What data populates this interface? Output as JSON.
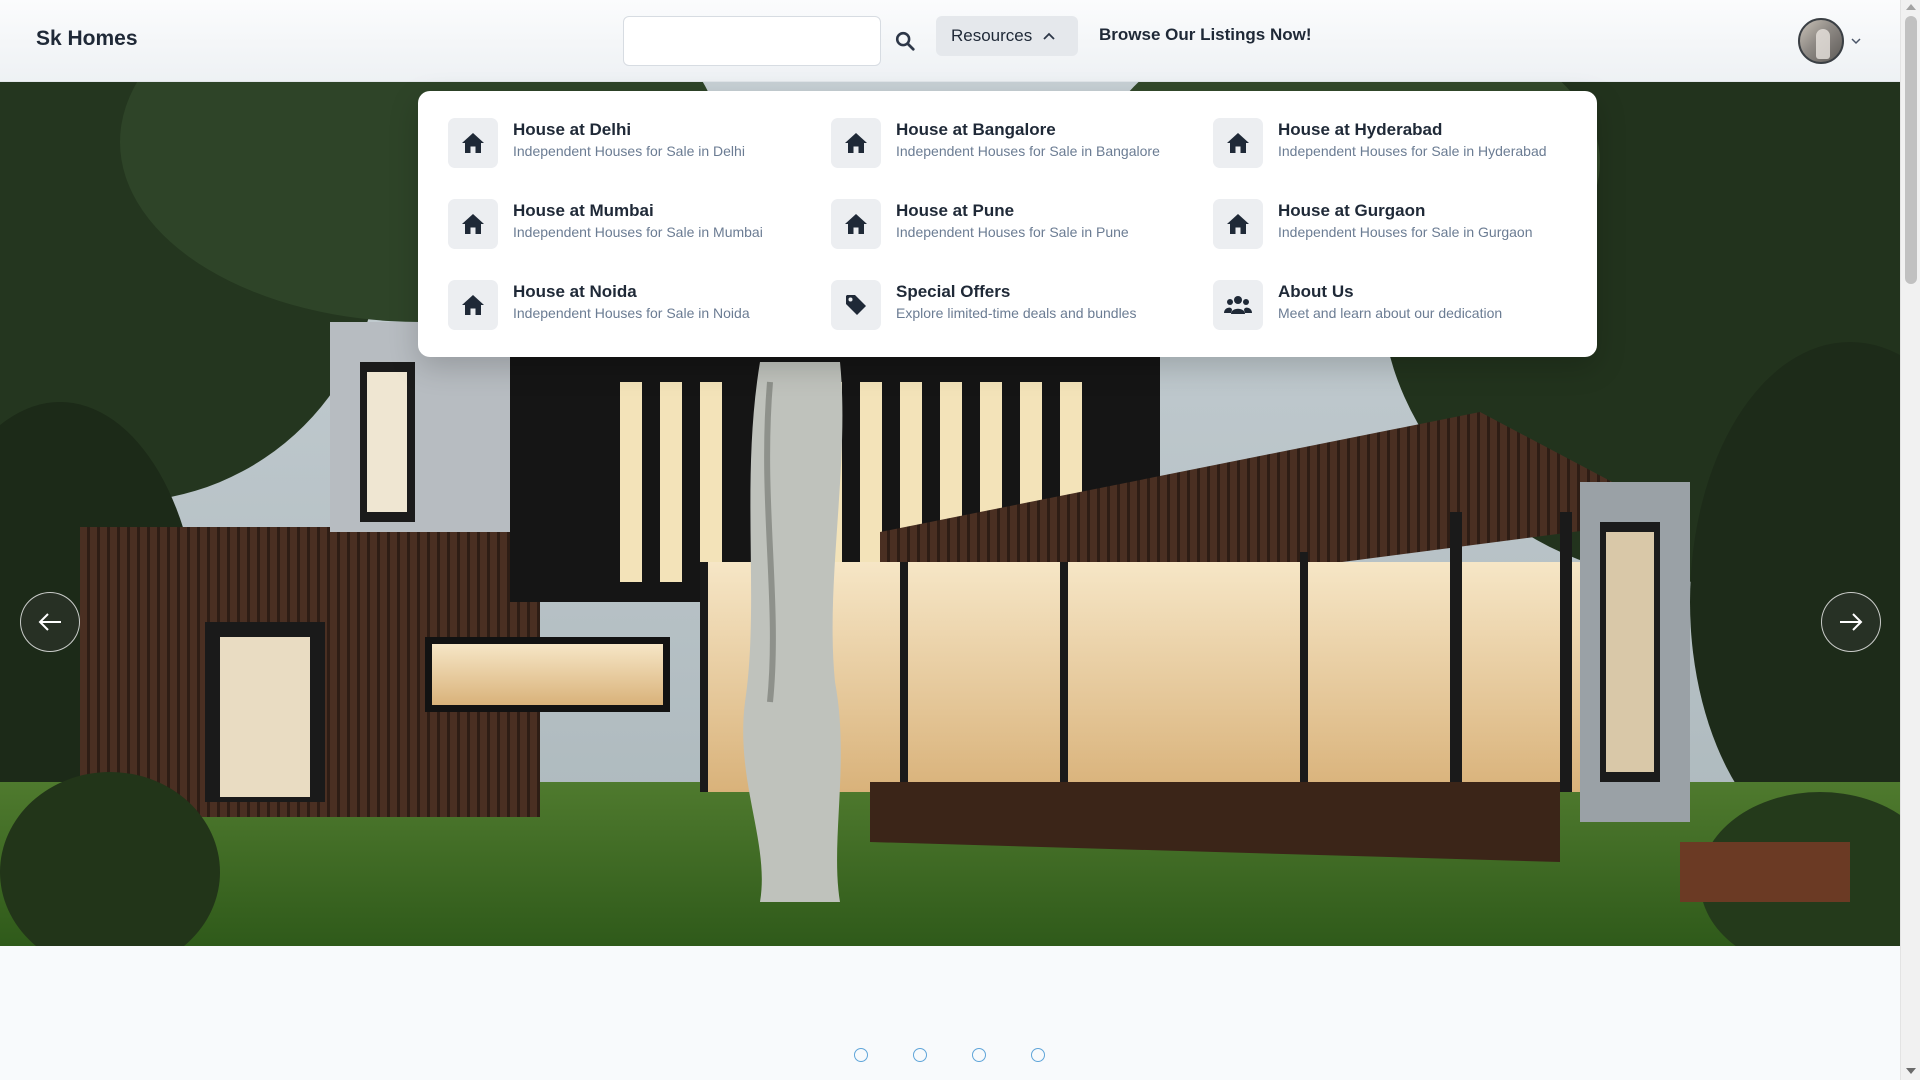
{
  "header": {
    "brand": "Sk Homes",
    "search": {
      "value": "",
      "placeholder": ""
    },
    "resources_label": "Resources",
    "browse_label": "Browse Our Listings Now!"
  },
  "resources_menu": {
    "items": [
      {
        "title": "House at Delhi",
        "description": "Independent Houses for Sale in Delhi",
        "icon": "house-icon"
      },
      {
        "title": "House at Bangalore",
        "description": "Independent Houses for Sale in Bangalore",
        "icon": "house-icon"
      },
      {
        "title": "House at Hyderabad",
        "description": "Independent Houses for Sale in Hyderabad",
        "icon": "house-icon"
      },
      {
        "title": "House at Mumbai",
        "description": "Independent Houses for Sale in Mumbai",
        "icon": "house-icon"
      },
      {
        "title": "House at Pune",
        "description": "Independent Houses for Sale in Pune",
        "icon": "house-icon"
      },
      {
        "title": "House at Gurgaon",
        "description": "Independent Houses for Sale in Gurgaon",
        "icon": "house-icon"
      },
      {
        "title": "House at Noida",
        "description": "Independent Houses for Sale in Noida",
        "icon": "house-icon"
      },
      {
        "title": "Special Offers",
        "description": "Explore limited-time deals and bundles",
        "icon": "tag-icon"
      },
      {
        "title": "About Us",
        "description": "Meet and learn about our dedication",
        "icon": "users-icon"
      }
    ]
  },
  "carousel": {
    "slide_count": 4,
    "prev_icon": "arrow-left-icon",
    "next_icon": "arrow-right-icon"
  },
  "colors": {
    "text_dark": "#1f2937",
    "text_muted": "#6b7c93",
    "indicator": "#60a5d9"
  }
}
